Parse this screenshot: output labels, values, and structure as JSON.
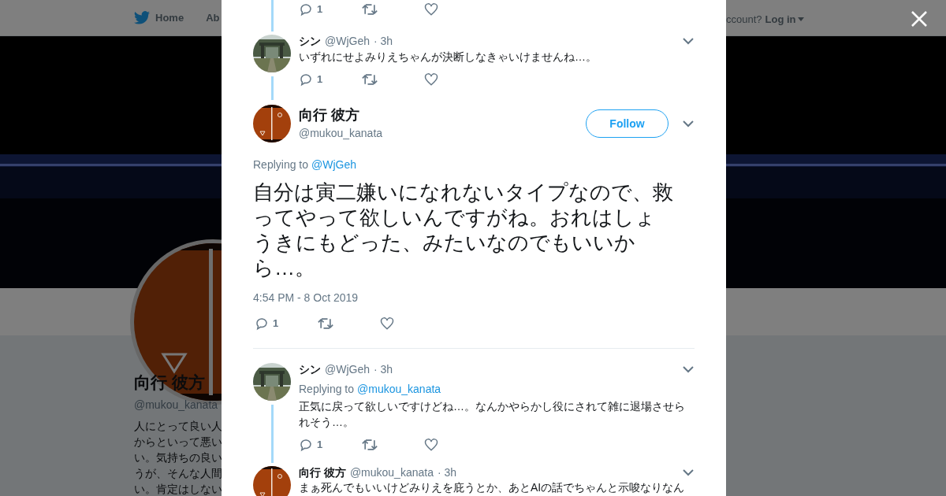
{
  "background_page": {
    "nav_items": [
      {
        "label": "Home"
      },
      {
        "label": "Ab"
      }
    ],
    "account_prompt": "ccount?",
    "login": "Log in",
    "profile": {
      "name": "向行 彼方",
      "handle": "@mukou_kanata",
      "bio_lines": [
        "人にとって良い人",
        "からといって悪い",
        "い。気持ちの良い",
        "うが、そんな人間",
        "い。肯定はしない"
      ]
    }
  },
  "modal": {
    "tweets": [
      {
        "kind": "actions",
        "thread_above": true,
        "reply_count": "1"
      },
      {
        "kind": "reply",
        "name": "シン",
        "handle": "@WjGeh",
        "time": "· 3h",
        "text": "いずれにせよみりえちゃんが決断しなきゃいけませんね…。",
        "reply_count": "1",
        "thread_below": true
      },
      {
        "kind": "focused",
        "name": "向行 彼方",
        "handle": "@mukou_kanata",
        "follow": "Follow",
        "replying_label": "Replying to",
        "replying_to": "@WjGeh",
        "text_lines": [
          "自分は寅二嫌いになれないタイプなので、救",
          "ってやって欲しいんですがね。おれはしょ",
          "うきにもどった、みたいなのでもいいか",
          "ら…。"
        ],
        "timestamp": "4:54 PM - 8 Oct 2019",
        "reply_count": "1"
      },
      {
        "kind": "reply",
        "name": "シン",
        "handle": "@WjGeh",
        "time": "· 3h",
        "replying_label": "Replying to",
        "replying_to": "@mukou_kanata",
        "text": "正気に戻って欲しいですけどね…。なんかやらかし役にされて雑に退場させられそう…。",
        "reply_count": "1",
        "thread_below": true
      },
      {
        "kind": "reply",
        "name": "向行 彼方",
        "handle": "@mukou_kanata",
        "time": "· 3h",
        "text": "まぁ死んでもいいけどみりえを庇うとか、あとAIの話でちゃんと示唆なりなん"
      }
    ]
  }
}
